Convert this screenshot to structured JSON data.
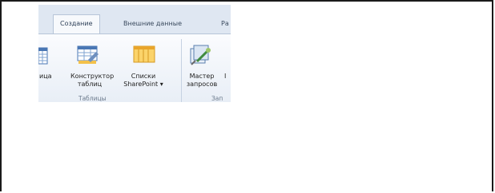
{
  "ribbon": {
    "tabs": [
      {
        "label": "Создание",
        "active": true
      },
      {
        "label": "Внешние данные",
        "active": false
      },
      {
        "label": "Ра",
        "active": false
      }
    ],
    "buttons": {
      "table_partial": "ица",
      "constructor_line1": "Конструктор",
      "constructor_line2": "таблиц",
      "lists_line1": "Списки",
      "lists_line2": "SharePoint ▾",
      "wizard_line1": "Мастер",
      "wizard_line2": "запросов"
    },
    "groups": {
      "tables": "Таблицы",
      "queries_partial": "Зап"
    },
    "colors": {
      "accent": "#2f5e9e",
      "lists_icon": "#f3b23a"
    }
  }
}
